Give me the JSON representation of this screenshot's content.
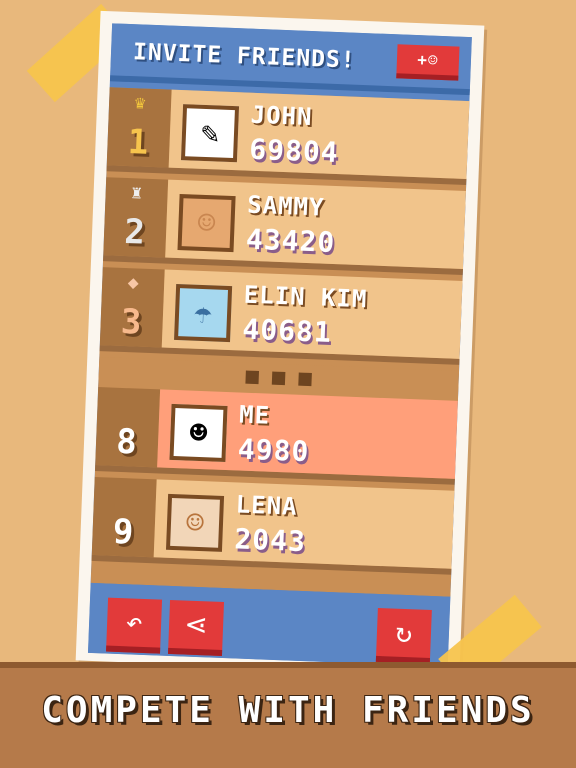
{
  "header": {
    "title": "INVITE FRIENDS!",
    "invite_icon": "+☺"
  },
  "leaderboard": [
    {
      "rank": "1",
      "rank_icon": "♛",
      "name": "JOHN",
      "score": "69804",
      "avatar": "✎"
    },
    {
      "rank": "2",
      "rank_icon": "♜",
      "name": "SAMMY",
      "score": "43420",
      "avatar": "☺"
    },
    {
      "rank": "3",
      "rank_icon": "◆",
      "name": "ELIN KIM",
      "score": "40681",
      "avatar": "☂"
    },
    {
      "rank": "8",
      "rank_icon": "",
      "name": "ME",
      "score": "4980",
      "avatar": "☻"
    },
    {
      "rank": "9",
      "rank_icon": "",
      "name": "LENA",
      "score": "2043",
      "avatar": "☺"
    }
  ],
  "separator": "■ ■ ■",
  "footer": {
    "back_icon": "↶",
    "share_icon": "⋖",
    "refresh_icon": "↻"
  },
  "banner": {
    "text": "COMPETE WITH FRIENDS"
  }
}
